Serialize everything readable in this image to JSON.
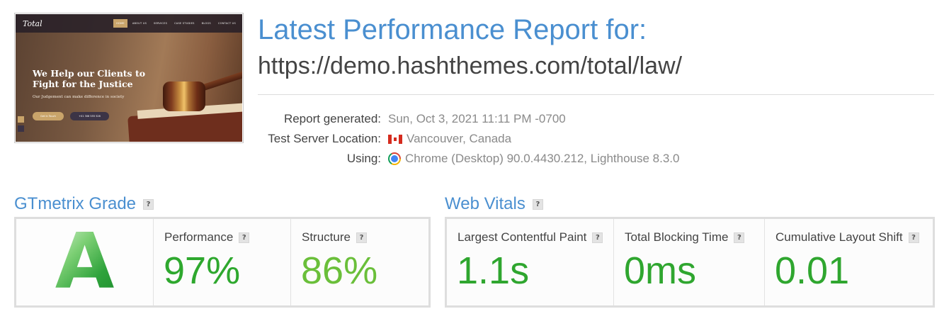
{
  "thumbnail": {
    "logo": "Total",
    "menu": [
      "HOME",
      "ABOUT US",
      "SERVICES",
      "CASE STUDIES",
      "BLOGS",
      "CONTACT US"
    ],
    "headline": "We Help our Clients to Fight for the Justice",
    "subtext": "Our Judgement can make difference in society",
    "button_primary": "Get In Touch",
    "button_secondary": "+01 306 555 526"
  },
  "header": {
    "title": "Latest Performance Report for:",
    "url": "https://demo.hashthemes.com/total/law/"
  },
  "meta": {
    "report_generated_label": "Report generated:",
    "report_generated_value": "Sun, Oct 3, 2021 11:11 PM -0700",
    "server_label": "Test Server Location:",
    "server_value": "Vancouver, Canada",
    "server_icon": "canada-flag-icon",
    "using_label": "Using:",
    "using_value": "Chrome (Desktop) 90.0.4430.212, Lighthouse 8.3.0",
    "using_icon": "chrome-icon"
  },
  "grade": {
    "title": "GTmetrix Grade",
    "help": "?",
    "letter": "A",
    "performance_label": "Performance",
    "performance_value": "97%",
    "structure_label": "Structure",
    "structure_value": "86%"
  },
  "vitals": {
    "title": "Web Vitals",
    "help": "?",
    "lcp_label": "Largest Contentful Paint",
    "lcp_value": "1.1s",
    "tbt_label": "Total Blocking Time",
    "tbt_value": "0ms",
    "cls_label": "Cumulative Layout Shift",
    "cls_value": "0.01"
  },
  "colors": {
    "accent_blue": "#4a8fd0",
    "grade_green": "#2fa33c",
    "performance_green": "#2ea82e",
    "structure_green": "#6abf3a",
    "vital_green": "#2fa62f"
  }
}
